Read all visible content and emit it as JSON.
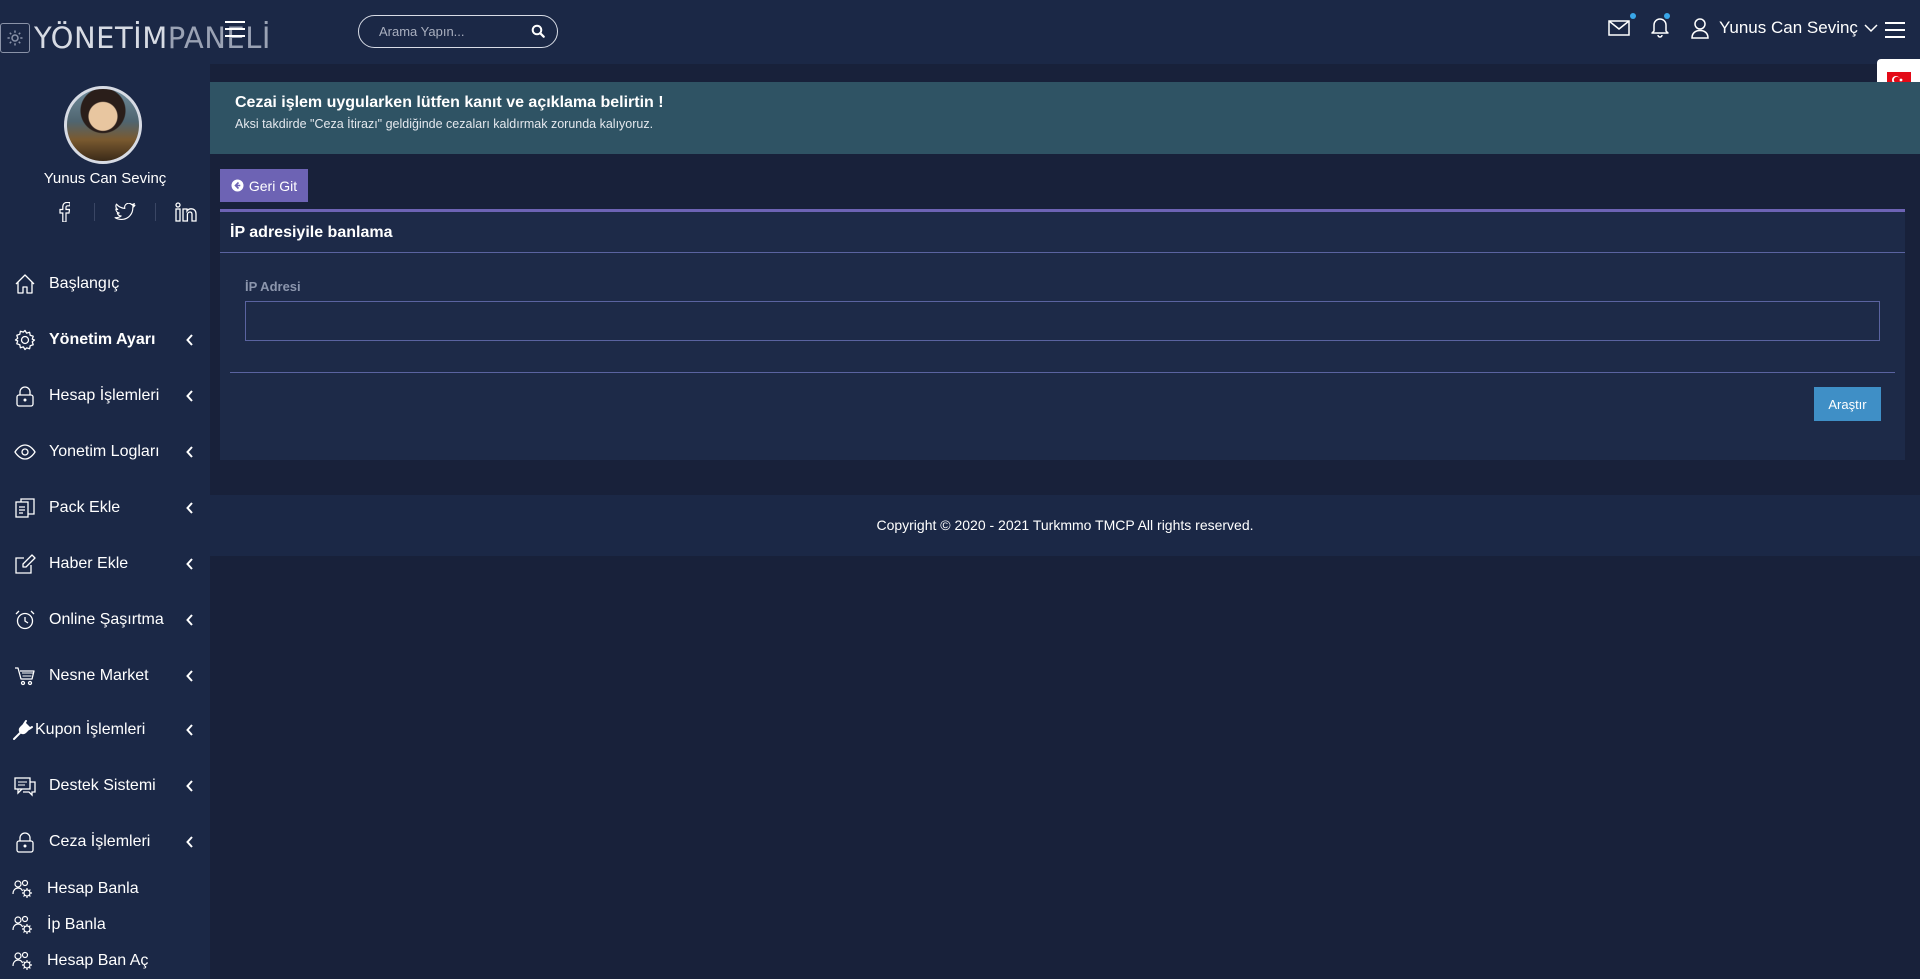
{
  "logo": {
    "bold": "YÖNETİM",
    "light": "PANELİ"
  },
  "search": {
    "placeholder": "Arama Yapın..."
  },
  "user": {
    "name": "Yunus Can Sevinç"
  },
  "profile": {
    "name": "Yunus Can Sevinç"
  },
  "sidebar": {
    "items": [
      {
        "label": "Başlangıç",
        "icon": "home-icon",
        "has_chevron": false,
        "bold": false
      },
      {
        "label": "Yönetim Ayarı",
        "icon": "gear-icon",
        "has_chevron": true,
        "bold": true
      },
      {
        "label": "Hesap İşlemleri",
        "icon": "lock-icon",
        "has_chevron": true,
        "bold": false
      },
      {
        "label": "Yonetim Logları",
        "icon": "eye-icon",
        "has_chevron": true,
        "bold": false
      },
      {
        "label": "Pack Ekle",
        "icon": "copy-icon",
        "has_chevron": true,
        "bold": false
      },
      {
        "label": "Haber Ekle",
        "icon": "edit-icon",
        "has_chevron": true,
        "bold": false
      },
      {
        "label": "Online Şaşırtma",
        "icon": "alarm-clock-icon",
        "has_chevron": true,
        "bold": false
      },
      {
        "label": "Nesne Market",
        "icon": "cart-icon",
        "has_chevron": true,
        "bold": false
      },
      {
        "label": "Kupon İşlemleri",
        "icon": "plug-icon",
        "has_chevron": true,
        "bold": false
      },
      {
        "label": "Destek Sistemi",
        "icon": "chat-icon",
        "has_chevron": true,
        "bold": false
      },
      {
        "label": "Ceza İşlemleri",
        "icon": "lock-icon",
        "has_chevron": true,
        "bold": false
      }
    ],
    "subitems": [
      {
        "label": "Hesap Banla",
        "icon": "users-gear-icon"
      },
      {
        "label": "İp Banla",
        "icon": "users-gear-icon"
      },
      {
        "label": "Hesap Ban Aç",
        "icon": "users-gear-icon"
      }
    ]
  },
  "alert": {
    "title": "Cezai işlem uygularken lütfen kanıt ve açıklama belirtin !",
    "text": "Aksi takdirde \"Ceza İtirazı\" geldiğinde cezaları kaldırmak zorunda kalıyoruz."
  },
  "back_button": {
    "label": "Geri Git"
  },
  "card": {
    "title": "İP adresiyile banlama",
    "field_label": "İP Adresi",
    "field_value": "",
    "submit_label": "Araştır"
  },
  "footer": {
    "text": "Copyright © 2020 - 2021 Turkmmo TMCP All rights reserved."
  },
  "colors": {
    "background": "#18213a",
    "panel": "#1b2846",
    "accent": "#6d63b4",
    "alert": "#2f5364",
    "button": "#3f8fc6"
  }
}
